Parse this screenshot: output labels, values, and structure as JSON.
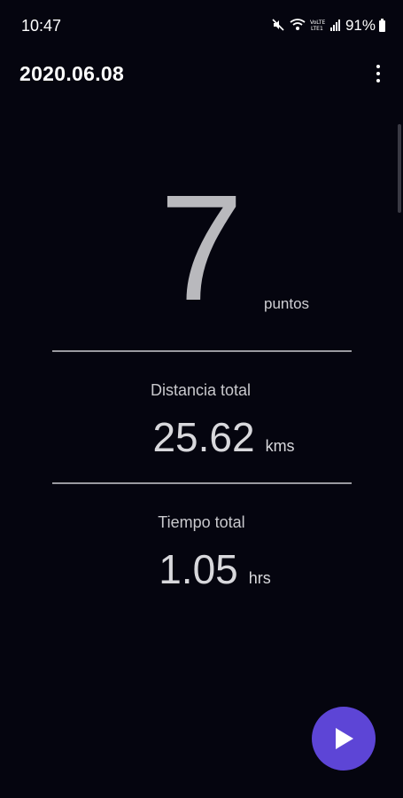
{
  "status_bar": {
    "time": "10:47",
    "battery": "91%",
    "icons": [
      "mute-icon",
      "wifi-icon",
      "volte-icon",
      "signal-icon",
      "battery-icon"
    ]
  },
  "header": {
    "title": "2020.06.08",
    "menu_icon": "more-vert-icon"
  },
  "points": {
    "value": "7",
    "unit": "puntos"
  },
  "distance": {
    "label": "Distancia total",
    "value": "25.62",
    "unit": "kms"
  },
  "time": {
    "label": "Tiempo total",
    "value": "1.05",
    "unit": "hrs"
  },
  "fab": {
    "icon": "play-icon",
    "color": "#5d45d6"
  },
  "colors": {
    "background": "#05050f",
    "accent": "#5d45d6"
  }
}
